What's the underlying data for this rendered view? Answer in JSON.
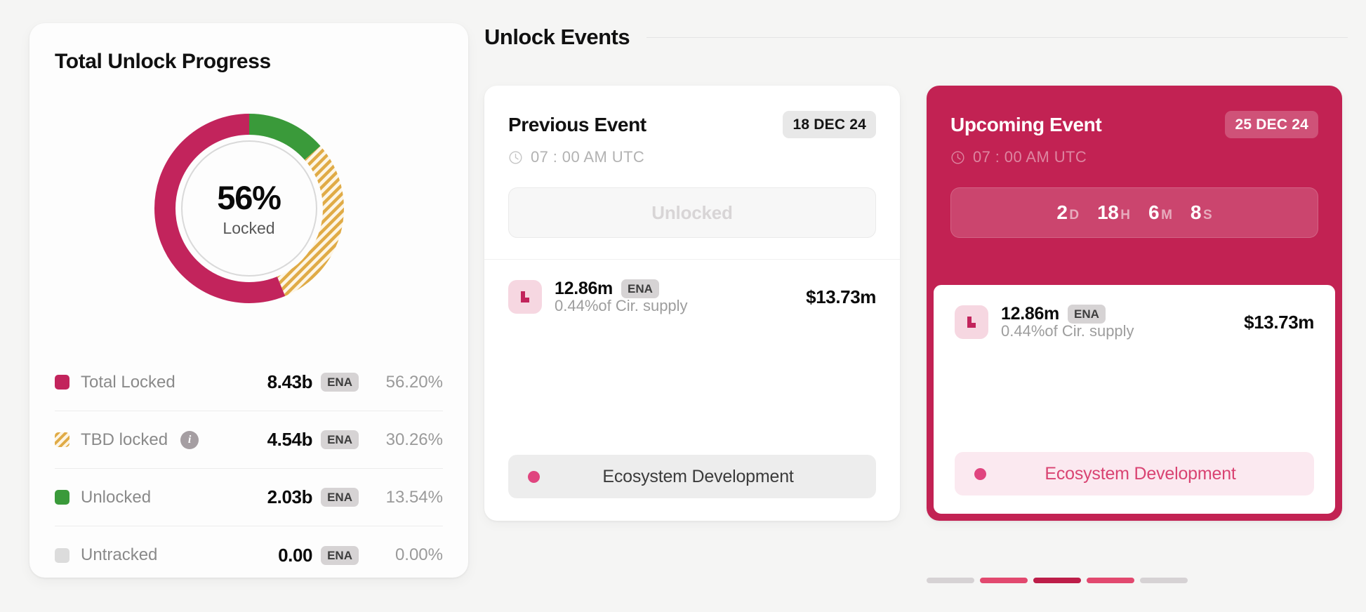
{
  "progress": {
    "title": "Total Unlock Progress",
    "donut": {
      "center_value": "56%",
      "center_label": "Locked"
    },
    "legend": [
      {
        "label": "Total Locked",
        "amount": "8.43b",
        "unit": "ENA",
        "percent": "56.20%",
        "color": "#c2245c",
        "has_info": false
      },
      {
        "label": "TBD locked",
        "amount": "4.54b",
        "unit": "ENA",
        "percent": "30.26%",
        "color": "#e0ab46",
        "has_info": true
      },
      {
        "label": "Unlocked",
        "amount": "2.03b",
        "unit": "ENA",
        "percent": "13.54%",
        "color": "#3a9a3a",
        "has_info": false
      },
      {
        "label": "Untracked",
        "amount": "0.00",
        "unit": "ENA",
        "percent": "0.00%",
        "color": "#dcdcdc",
        "has_info": false
      }
    ]
  },
  "events": {
    "title": "Unlock Events",
    "previous": {
      "name": "Previous Event",
      "date": "18 DEC 24",
      "time": "07 : 00 AM UTC",
      "status_label": "Unlocked",
      "token": {
        "amount": "12.86m",
        "unit": "ENA",
        "subtext": "0.44%of Cir. supply",
        "usd": "$13.73m"
      },
      "tag": "Ecosystem Development",
      "tag_dot_color": "#e0457f"
    },
    "upcoming": {
      "name": "Upcoming Event",
      "date": "25 DEC 24",
      "time": "07 : 00 AM UTC",
      "countdown": [
        {
          "value": "2",
          "unit": "D"
        },
        {
          "value": "18",
          "unit": "H"
        },
        {
          "value": "6",
          "unit": "M"
        },
        {
          "value": "8",
          "unit": "S"
        }
      ],
      "token": {
        "amount": "12.86m",
        "unit": "ENA",
        "subtext": "0.44%of Cir. supply",
        "usd": "$13.73m"
      },
      "tag": "Ecosystem Development",
      "tag_dot_color": "#e0457f",
      "accent_color": "#c22253"
    },
    "pagination": [
      {
        "state": "inactive",
        "color": "#d6d2d4"
      },
      {
        "state": "near",
        "color": "#e2496f"
      },
      {
        "state": "active",
        "color": "#bd1e49"
      },
      {
        "state": "near",
        "color": "#e2496f"
      },
      {
        "state": "inactive",
        "color": "#d6d2d4"
      }
    ]
  },
  "chart_data": {
    "type": "pie",
    "title": "Total Unlock Progress",
    "categories": [
      "Total Locked",
      "TBD locked",
      "Unlocked",
      "Untracked"
    ],
    "values": [
      56.2,
      30.26,
      13.54,
      0.0
    ],
    "raw_amounts": [
      "8.43b",
      "4.54b",
      "2.03b",
      "0.00"
    ],
    "unit": "ENA",
    "colors": [
      "#c2245c",
      "#e0ab46",
      "#3a9a3a",
      "#dcdcdc"
    ],
    "center_value": "56%",
    "center_label": "Locked",
    "legend_position": "below",
    "donut": true
  }
}
